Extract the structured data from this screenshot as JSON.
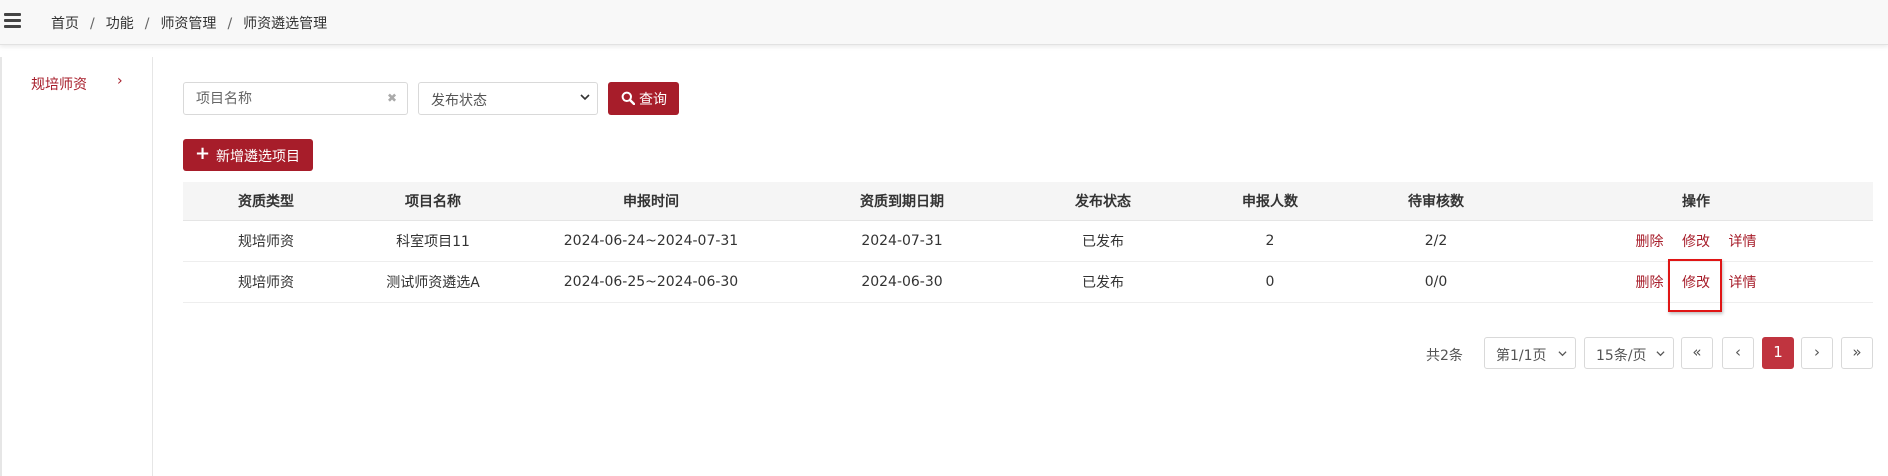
{
  "breadcrumb": {
    "items": [
      "首页",
      "功能",
      "师资管理",
      "师资遴选管理"
    ],
    "separator": "/"
  },
  "icons": {
    "menu": "hamburger-icon",
    "clear": "clear-icon",
    "caret": "chevron-down-icon",
    "search": "search-icon",
    "add": "plus-icon"
  },
  "sidebar": {
    "items": [
      {
        "label": "规培师资",
        "chevron": "›",
        "active": true
      }
    ]
  },
  "filters": {
    "name_placeholder": "项目名称",
    "clear_glyph": "✖",
    "status_selected": "发布状态",
    "query_label": "查询"
  },
  "toolbar": {
    "add_glyph": "+",
    "add_label": "新增遴选项目"
  },
  "table": {
    "headers": [
      "资质类型",
      "项目名称",
      "申报时间",
      "资质到期日期",
      "发布状态",
      "申报人数",
      "待审核数",
      "操作"
    ],
    "rows": [
      {
        "type": "规培师资",
        "name": "科室项目11",
        "apply_period": "2024-06-24~2024-07-31",
        "expire_date": "2024-07-31",
        "status": "已发布",
        "applicants": "2",
        "pending": "2/2"
      },
      {
        "type": "规培师资",
        "name": "测试师资遴选A",
        "apply_period": "2024-06-25~2024-06-30",
        "expire_date": "2024-06-30",
        "status": "已发布",
        "applicants": "0",
        "pending": "0/0"
      }
    ],
    "actions": {
      "delete": "删除",
      "edit": "修改",
      "detail": "详情"
    }
  },
  "pagination": {
    "total": "共2条",
    "page_select": "第1/1页",
    "size_select": "15条/页",
    "first": "«",
    "prev": "‹",
    "current": "1",
    "next": "›",
    "last": "»"
  },
  "colors": {
    "accent": "#a71d2a",
    "highlight_box": "#e01515"
  }
}
